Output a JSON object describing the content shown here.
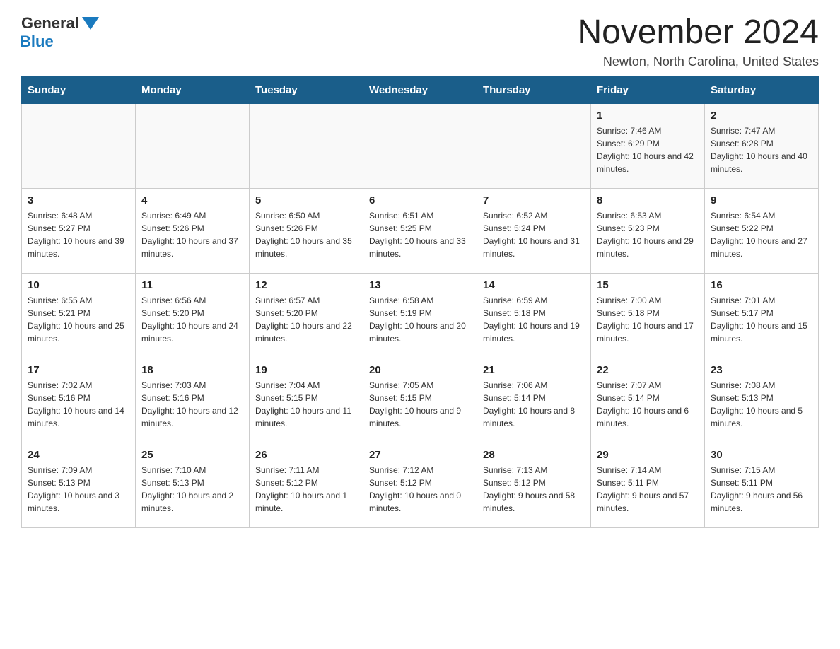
{
  "header": {
    "logo_general": "General",
    "logo_blue": "Blue",
    "month_title": "November 2024",
    "location": "Newton, North Carolina, United States"
  },
  "weekdays": [
    "Sunday",
    "Monday",
    "Tuesday",
    "Wednesday",
    "Thursday",
    "Friday",
    "Saturday"
  ],
  "weeks": [
    [
      {
        "day": "",
        "sunrise": "",
        "sunset": "",
        "daylight": ""
      },
      {
        "day": "",
        "sunrise": "",
        "sunset": "",
        "daylight": ""
      },
      {
        "day": "",
        "sunrise": "",
        "sunset": "",
        "daylight": ""
      },
      {
        "day": "",
        "sunrise": "",
        "sunset": "",
        "daylight": ""
      },
      {
        "day": "",
        "sunrise": "",
        "sunset": "",
        "daylight": ""
      },
      {
        "day": "1",
        "sunrise": "Sunrise: 7:46 AM",
        "sunset": "Sunset: 6:29 PM",
        "daylight": "Daylight: 10 hours and 42 minutes."
      },
      {
        "day": "2",
        "sunrise": "Sunrise: 7:47 AM",
        "sunset": "Sunset: 6:28 PM",
        "daylight": "Daylight: 10 hours and 40 minutes."
      }
    ],
    [
      {
        "day": "3",
        "sunrise": "Sunrise: 6:48 AM",
        "sunset": "Sunset: 5:27 PM",
        "daylight": "Daylight: 10 hours and 39 minutes."
      },
      {
        "day": "4",
        "sunrise": "Sunrise: 6:49 AM",
        "sunset": "Sunset: 5:26 PM",
        "daylight": "Daylight: 10 hours and 37 minutes."
      },
      {
        "day": "5",
        "sunrise": "Sunrise: 6:50 AM",
        "sunset": "Sunset: 5:26 PM",
        "daylight": "Daylight: 10 hours and 35 minutes."
      },
      {
        "day": "6",
        "sunrise": "Sunrise: 6:51 AM",
        "sunset": "Sunset: 5:25 PM",
        "daylight": "Daylight: 10 hours and 33 minutes."
      },
      {
        "day": "7",
        "sunrise": "Sunrise: 6:52 AM",
        "sunset": "Sunset: 5:24 PM",
        "daylight": "Daylight: 10 hours and 31 minutes."
      },
      {
        "day": "8",
        "sunrise": "Sunrise: 6:53 AM",
        "sunset": "Sunset: 5:23 PM",
        "daylight": "Daylight: 10 hours and 29 minutes."
      },
      {
        "day": "9",
        "sunrise": "Sunrise: 6:54 AM",
        "sunset": "Sunset: 5:22 PM",
        "daylight": "Daylight: 10 hours and 27 minutes."
      }
    ],
    [
      {
        "day": "10",
        "sunrise": "Sunrise: 6:55 AM",
        "sunset": "Sunset: 5:21 PM",
        "daylight": "Daylight: 10 hours and 25 minutes."
      },
      {
        "day": "11",
        "sunrise": "Sunrise: 6:56 AM",
        "sunset": "Sunset: 5:20 PM",
        "daylight": "Daylight: 10 hours and 24 minutes."
      },
      {
        "day": "12",
        "sunrise": "Sunrise: 6:57 AM",
        "sunset": "Sunset: 5:20 PM",
        "daylight": "Daylight: 10 hours and 22 minutes."
      },
      {
        "day": "13",
        "sunrise": "Sunrise: 6:58 AM",
        "sunset": "Sunset: 5:19 PM",
        "daylight": "Daylight: 10 hours and 20 minutes."
      },
      {
        "day": "14",
        "sunrise": "Sunrise: 6:59 AM",
        "sunset": "Sunset: 5:18 PM",
        "daylight": "Daylight: 10 hours and 19 minutes."
      },
      {
        "day": "15",
        "sunrise": "Sunrise: 7:00 AM",
        "sunset": "Sunset: 5:18 PM",
        "daylight": "Daylight: 10 hours and 17 minutes."
      },
      {
        "day": "16",
        "sunrise": "Sunrise: 7:01 AM",
        "sunset": "Sunset: 5:17 PM",
        "daylight": "Daylight: 10 hours and 15 minutes."
      }
    ],
    [
      {
        "day": "17",
        "sunrise": "Sunrise: 7:02 AM",
        "sunset": "Sunset: 5:16 PM",
        "daylight": "Daylight: 10 hours and 14 minutes."
      },
      {
        "day": "18",
        "sunrise": "Sunrise: 7:03 AM",
        "sunset": "Sunset: 5:16 PM",
        "daylight": "Daylight: 10 hours and 12 minutes."
      },
      {
        "day": "19",
        "sunrise": "Sunrise: 7:04 AM",
        "sunset": "Sunset: 5:15 PM",
        "daylight": "Daylight: 10 hours and 11 minutes."
      },
      {
        "day": "20",
        "sunrise": "Sunrise: 7:05 AM",
        "sunset": "Sunset: 5:15 PM",
        "daylight": "Daylight: 10 hours and 9 minutes."
      },
      {
        "day": "21",
        "sunrise": "Sunrise: 7:06 AM",
        "sunset": "Sunset: 5:14 PM",
        "daylight": "Daylight: 10 hours and 8 minutes."
      },
      {
        "day": "22",
        "sunrise": "Sunrise: 7:07 AM",
        "sunset": "Sunset: 5:14 PM",
        "daylight": "Daylight: 10 hours and 6 minutes."
      },
      {
        "day": "23",
        "sunrise": "Sunrise: 7:08 AM",
        "sunset": "Sunset: 5:13 PM",
        "daylight": "Daylight: 10 hours and 5 minutes."
      }
    ],
    [
      {
        "day": "24",
        "sunrise": "Sunrise: 7:09 AM",
        "sunset": "Sunset: 5:13 PM",
        "daylight": "Daylight: 10 hours and 3 minutes."
      },
      {
        "day": "25",
        "sunrise": "Sunrise: 7:10 AM",
        "sunset": "Sunset: 5:13 PM",
        "daylight": "Daylight: 10 hours and 2 minutes."
      },
      {
        "day": "26",
        "sunrise": "Sunrise: 7:11 AM",
        "sunset": "Sunset: 5:12 PM",
        "daylight": "Daylight: 10 hours and 1 minute."
      },
      {
        "day": "27",
        "sunrise": "Sunrise: 7:12 AM",
        "sunset": "Sunset: 5:12 PM",
        "daylight": "Daylight: 10 hours and 0 minutes."
      },
      {
        "day": "28",
        "sunrise": "Sunrise: 7:13 AM",
        "sunset": "Sunset: 5:12 PM",
        "daylight": "Daylight: 9 hours and 58 minutes."
      },
      {
        "day": "29",
        "sunrise": "Sunrise: 7:14 AM",
        "sunset": "Sunset: 5:11 PM",
        "daylight": "Daylight: 9 hours and 57 minutes."
      },
      {
        "day": "30",
        "sunrise": "Sunrise: 7:15 AM",
        "sunset": "Sunset: 5:11 PM",
        "daylight": "Daylight: 9 hours and 56 minutes."
      }
    ]
  ]
}
